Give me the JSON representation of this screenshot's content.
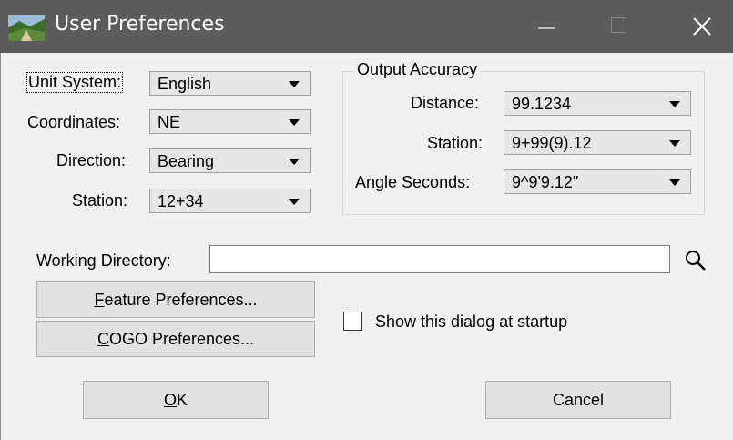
{
  "window": {
    "title": "User Preferences",
    "icon": "app-landscape-icon"
  },
  "left_fields": [
    {
      "label": "Unit System:",
      "value": "English"
    },
    {
      "label": "Coordinates:",
      "value": "NE"
    },
    {
      "label": "Direction:",
      "value": "Bearing"
    },
    {
      "label": "Station:",
      "value": "12+34"
    }
  ],
  "output_accuracy": {
    "title": "Output Accuracy",
    "fields": [
      {
        "label": "Distance:",
        "value": "99.1234"
      },
      {
        "label": "Station:",
        "value": "9+99(9).12"
      },
      {
        "label": "Angle Seconds:",
        "value": "9^9'9.12\""
      }
    ]
  },
  "working_directory": {
    "label": "Working Directory:",
    "value": ""
  },
  "buttons": {
    "feature_preferences": {
      "accel": "F",
      "rest": "eature Preferences..."
    },
    "cogo_preferences": {
      "accel": "C",
      "rest": "OGO Preferences..."
    },
    "ok": {
      "accel": "O",
      "rest": "K"
    },
    "cancel": "Cancel"
  },
  "startup_checkbox": {
    "label": "Show this dialog at startup",
    "checked": false
  }
}
